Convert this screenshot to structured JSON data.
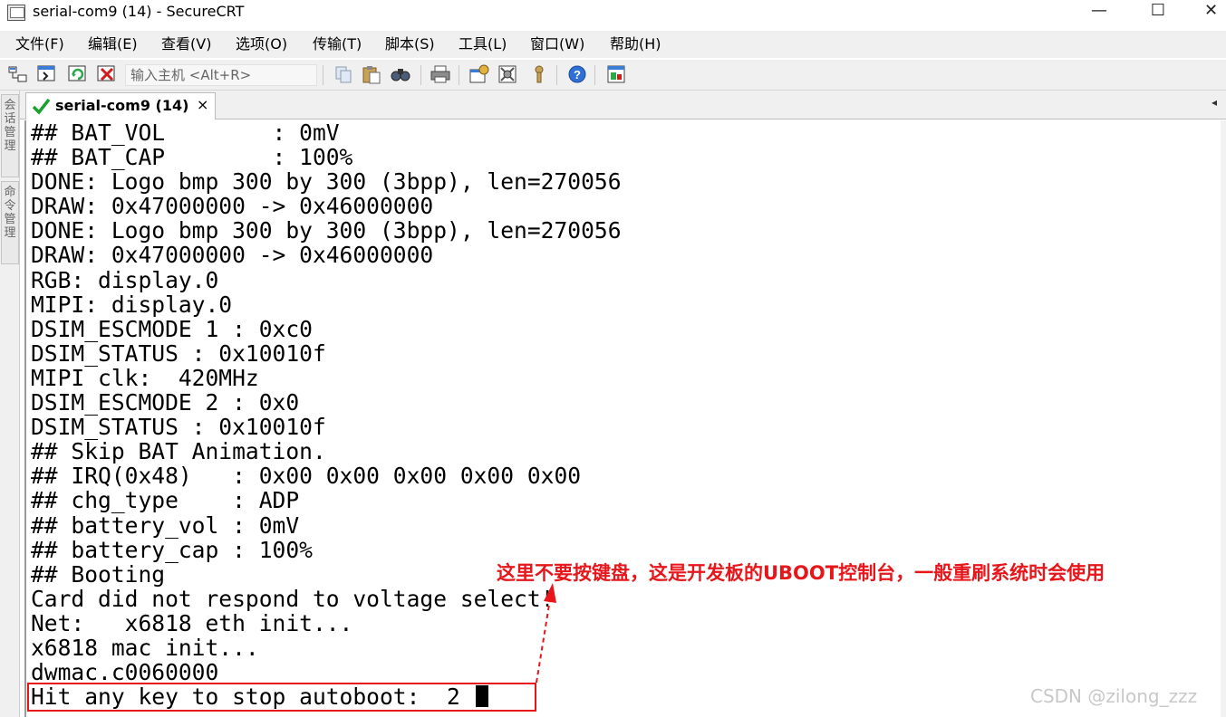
{
  "window": {
    "title": "serial-com9 (14) - SecureCRT",
    "min_glyph": "—",
    "max_glyph": "☐",
    "close_glyph": "✕",
    "icon": "securecrt-app-icon"
  },
  "menu": {
    "items": [
      {
        "label": "文件(F)"
      },
      {
        "label": "编辑(E)"
      },
      {
        "label": "查看(V)"
      },
      {
        "label": "选项(O)"
      },
      {
        "label": "传输(T)"
      },
      {
        "label": "脚本(S)"
      },
      {
        "label": "工具(L)"
      },
      {
        "label": "窗口(W)"
      },
      {
        "label": "帮助(H)"
      }
    ]
  },
  "toolbar": {
    "host_placeholder": "输入主机 <Alt+R>",
    "icons": [
      "connect-bar-icon",
      "quick-connect-icon",
      "reconnect-icon",
      "disconnect-icon",
      "copy-icon",
      "paste-icon",
      "find-icon",
      "print-icon",
      "session-options-icon",
      "global-options-icon",
      "keymap-icon",
      "help-icon",
      "sftp-icon"
    ]
  },
  "sidepanel": {
    "session_manager": "会话管理",
    "command_manager": "命令管理"
  },
  "tab": {
    "label": "serial-com9 (14)",
    "close": "×",
    "status_icon": "connected-check-icon",
    "scroll_glyph": "◂"
  },
  "terminal": {
    "lines": [
      "## BAT_VOL        : 0mV",
      "## BAT_CAP        : 100%",
      "DONE: Logo bmp 300 by 300 (3bpp), len=270056",
      "DRAW: 0x47000000 -> 0x46000000",
      "DONE: Logo bmp 300 by 300 (3bpp), len=270056",
      "DRAW: 0x47000000 -> 0x46000000",
      "RGB: display.0",
      "MIPI: display.0",
      "DSIM_ESCMODE 1 : 0xc0",
      "DSIM_STATUS : 0x10010f",
      "MIPI clk:  420MHz",
      "DSIM_ESCMODE 2 : 0x0",
      "DSIM_STATUS : 0x10010f",
      "## Skip BAT Animation.",
      "## IRQ(0x48)   : 0x00 0x00 0x00 0x00 0x00",
      "## chg_type    : ADP",
      "## battery_vol : 0mV",
      "## battery_cap : 100%",
      "## Booting",
      "Card did not respond to voltage select!",
      "Net:   x6818 eth init...",
      "x6818 mac init...",
      "dwmac.c0060000"
    ],
    "prompt_line": "Hit any key to stop autoboot:  2 "
  },
  "annotation": {
    "text": "这里不要按键盘，这是开发板的UBOOT控制台，一般重刷系统时会使用",
    "color": "#e6161b"
  },
  "watermark": "CSDN @zilong_zzz"
}
